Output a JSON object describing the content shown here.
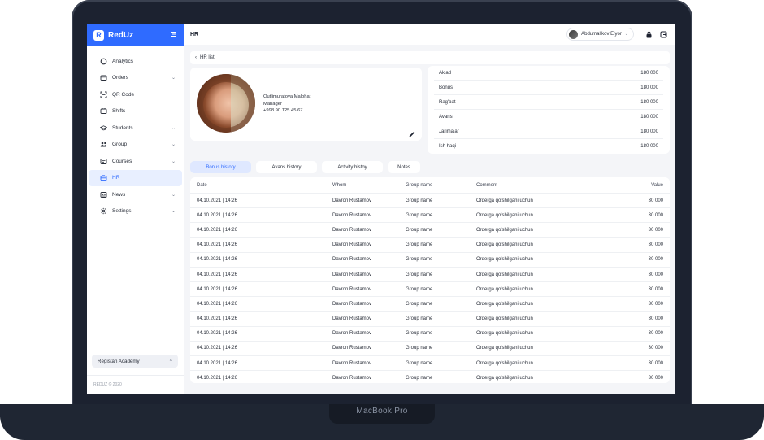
{
  "device": {
    "label": "MacBook Pro"
  },
  "sidebar": {
    "logo": "RedUz",
    "items": [
      {
        "label": "Analytics",
        "icon": "circle-icon",
        "chevron": ""
      },
      {
        "label": "Orders",
        "icon": "orders-icon",
        "chevron": "⌄"
      },
      {
        "label": "QR Code",
        "icon": "qr-code-icon",
        "chevron": ""
      },
      {
        "label": "Shifts",
        "icon": "shifts-icon",
        "chevron": ""
      },
      {
        "label": "Students",
        "icon": "graduation-cap-icon",
        "chevron": "⌄"
      },
      {
        "label": "Group",
        "icon": "group-icon",
        "chevron": "⌄"
      },
      {
        "label": "Courses",
        "icon": "courses-icon",
        "chevron": "⌄"
      },
      {
        "label": "HR",
        "icon": "briefcase-icon",
        "chevron": ""
      },
      {
        "label": "News",
        "icon": "news-icon",
        "chevron": "⌄"
      },
      {
        "label": "Settings",
        "icon": "gear-icon",
        "chevron": "⌄"
      }
    ],
    "academy": "Registan Academy",
    "copyright": "REDUZ © 2020"
  },
  "header": {
    "title": "HR",
    "user": "Abdumalikov Elyor"
  },
  "breadcrumb": "HR list",
  "profile": {
    "name": "Qutlimuratova Malohat",
    "role": "Manager",
    "phone": "+998 90 125 45 67"
  },
  "payroll": [
    {
      "label": "Aklad",
      "value": "180 000"
    },
    {
      "label": "Bonus",
      "value": "180 000"
    },
    {
      "label": "Rag'bat",
      "value": "180 000"
    },
    {
      "label": "Avans",
      "value": "180 000"
    },
    {
      "label": "Jarimalar",
      "value": "180 000"
    },
    {
      "label": "Ish haqi",
      "value": "180 000"
    }
  ],
  "tabs": [
    {
      "label": "Bonus history",
      "active": true
    },
    {
      "label": "Avans history",
      "active": false
    },
    {
      "label": "Activity histoy",
      "active": false
    },
    {
      "label": "Notes",
      "active": false
    }
  ],
  "table": {
    "columns": [
      "Date",
      "Whom",
      "Group name",
      "Comment",
      "Value"
    ],
    "rows": [
      [
        "04.10.2021 | 14:26",
        "Davron Rustamov",
        "Group name",
        "Orderga qo'shilgani uchun",
        "30 000"
      ],
      [
        "04.10.2021 | 14:26",
        "Davron Rustamov",
        "Group name",
        "Orderga qo'shilgani uchun",
        "30 000"
      ],
      [
        "04.10.2021 | 14:26",
        "Davron Rustamov",
        "Group name",
        "Orderga qo'shilgani uchun",
        "30 000"
      ],
      [
        "04.10.2021 | 14:26",
        "Davron Rustamov",
        "Group name",
        "Orderga qo'shilgani uchun",
        "30 000"
      ],
      [
        "04.10.2021 | 14:26",
        "Davron Rustamov",
        "Group name",
        "Orderga qo'shilgani uchun",
        "30 000"
      ],
      [
        "04.10.2021 | 14:26",
        "Davron Rustamov",
        "Group name",
        "Orderga qo'shilgani uchun",
        "30 000"
      ],
      [
        "04.10.2021 | 14:26",
        "Davron Rustamov",
        "Group name",
        "Orderga qo'shilgani uchun",
        "30 000"
      ],
      [
        "04.10.2021 | 14:26",
        "Davron Rustamov",
        "Group name",
        "Orderga qo'shilgani uchun",
        "30 000"
      ],
      [
        "04.10.2021 | 14:26",
        "Davron Rustamov",
        "Group name",
        "Orderga qo'shilgani uchun",
        "30 000"
      ],
      [
        "04.10.2021 | 14:26",
        "Davron Rustamov",
        "Group name",
        "Orderga qo'shilgani uchun",
        "30 000"
      ],
      [
        "04.10.2021 | 14:26",
        "Davron Rustamov",
        "Group name",
        "Orderga qo'shilgani uchun",
        "30 000"
      ],
      [
        "04.10.2021 | 14:26",
        "Davron Rustamov",
        "Group name",
        "Orderga qo'shilgani uchun",
        "30 000"
      ],
      [
        "04.10.2021 | 14:26",
        "Davron Rustamov",
        "Group name",
        "Orderga qo'shilgani uchun",
        "30 000"
      ]
    ]
  },
  "colors": {
    "accent": "#2f6bff",
    "active_bg": "#e8efff"
  }
}
